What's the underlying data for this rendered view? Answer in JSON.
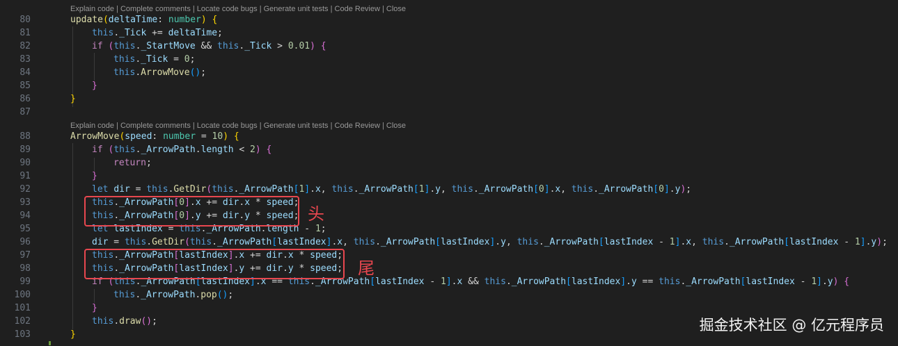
{
  "code_lens_1": "Explain code | Complete comments | Locate code bugs | Generate unit tests | Code Review | Close",
  "code_lens_2": "Explain code | Complete comments | Locate code bugs | Generate unit tests | Code Review | Close",
  "lines": [
    {
      "num": "80",
      "text": "update(deltaTime: number) {"
    },
    {
      "num": "81",
      "text": "this._Tick += deltaTime;"
    },
    {
      "num": "82",
      "text": "if (this._StartMove && this._Tick > 0.01) {"
    },
    {
      "num": "83",
      "text": "this._Tick = 0;"
    },
    {
      "num": "84",
      "text": "this.ArrowMove();"
    },
    {
      "num": "85",
      "text": "}"
    },
    {
      "num": "86",
      "text": "}"
    },
    {
      "num": "87",
      "text": ""
    },
    {
      "num": "88",
      "text": "ArrowMove(speed: number = 10) {"
    },
    {
      "num": "89",
      "text": "if (this._ArrowPath.length < 2) {"
    },
    {
      "num": "90",
      "text": "return;"
    },
    {
      "num": "91",
      "text": "}"
    },
    {
      "num": "92",
      "text": "let dir = this.GetDir(this._ArrowPath[1].x, this._ArrowPath[1].y, this._ArrowPath[0].x, this._ArrowPath[0].y);"
    },
    {
      "num": "93",
      "text": "this._ArrowPath[0].x += dir.x * speed;"
    },
    {
      "num": "94",
      "text": "this._ArrowPath[0].y += dir.y * speed;"
    },
    {
      "num": "95",
      "text": "let lastIndex = this._ArrowPath.length - 1;"
    },
    {
      "num": "96",
      "text": "dir = this.GetDir(this._ArrowPath[lastIndex].x, this._ArrowPath[lastIndex].y, this._ArrowPath[lastIndex - 1].x, this._ArrowPath[lastIndex - 1].y);"
    },
    {
      "num": "97",
      "text": "this._ArrowPath[lastIndex].x += dir.x * speed;"
    },
    {
      "num": "98",
      "text": "this._ArrowPath[lastIndex].y += dir.y * speed;"
    },
    {
      "num": "99",
      "text": "if (this._ArrowPath[lastIndex].x == this._ArrowPath[lastIndex - 1].x && this._ArrowPath[lastIndex].y == this._ArrowPath[lastIndex - 1].y) {"
    },
    {
      "num": "100",
      "text": "this._ArrowPath.pop();"
    },
    {
      "num": "101",
      "text": "}"
    },
    {
      "num": "102",
      "text": "this.draw();"
    },
    {
      "num": "103",
      "text": "}"
    }
  ],
  "annotations": {
    "head": "头",
    "tail": "尾",
    "color": "#e8474f"
  },
  "watermark": "掘金技术社区 @ 亿元程序员",
  "colors": {
    "background": "#1f1f1f",
    "keyword": "#569cd6",
    "function": "#dcdcaa",
    "variable": "#9cdcfe",
    "number": "#b5cea8"
  }
}
